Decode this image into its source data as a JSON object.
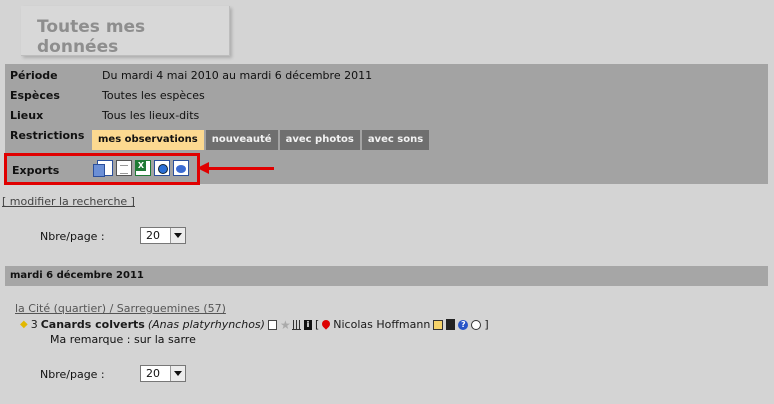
{
  "page": {
    "title": "Toutes mes données"
  },
  "criteria": {
    "periode_label": "Période",
    "periode_value": "Du mardi 4 mai 2010 au mardi 6 décembre 2011",
    "especes_label": "Espèces",
    "especes_value": "Toutes les espèces",
    "lieux_label": "Lieux",
    "lieux_value": "Tous les lieux-dits",
    "restrictions_label": "Restrictions",
    "tabs": [
      "mes observations",
      "nouveauté",
      "avec photos",
      "avec sons"
    ],
    "exports_label": "Exports",
    "export_icons": [
      "copy-export-icon",
      "document-export-icon",
      "excel-export-icon",
      "image-export-icon",
      "globe-export-icon"
    ]
  },
  "modify_search": "[ modifier la recherche ]",
  "pager": {
    "label": "Nbre/page :",
    "value": "20"
  },
  "results": {
    "day_header": "mardi 6 décembre 2011",
    "place": "la Cité (quartier) / Sarreguemines (57)",
    "observation": {
      "count": "3",
      "species": "Canards colverts",
      "latin": "(Anas platyrhynchos)",
      "observer": "Nicolas Hoffmann",
      "bracket_open": "[",
      "bracket_close": "]",
      "remark": "Ma remarque : sur la sarre"
    }
  },
  "colors": {
    "background": "#d4d4d4",
    "panel": "#a3a3a3",
    "tab_active": "#fcd990",
    "tab_inactive": "#6f6f6f",
    "highlight": "#e00000"
  }
}
